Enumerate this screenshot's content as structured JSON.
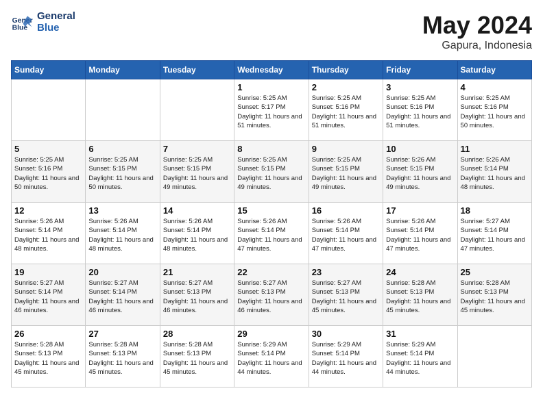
{
  "header": {
    "logo_line1": "General",
    "logo_line2": "Blue",
    "month": "May 2024",
    "location": "Gapura, Indonesia"
  },
  "weekdays": [
    "Sunday",
    "Monday",
    "Tuesday",
    "Wednesday",
    "Thursday",
    "Friday",
    "Saturday"
  ],
  "weeks": [
    [
      {
        "day": "",
        "sunrise": "",
        "sunset": "",
        "daylight": ""
      },
      {
        "day": "",
        "sunrise": "",
        "sunset": "",
        "daylight": ""
      },
      {
        "day": "",
        "sunrise": "",
        "sunset": "",
        "daylight": ""
      },
      {
        "day": "1",
        "sunrise": "Sunrise: 5:25 AM",
        "sunset": "Sunset: 5:17 PM",
        "daylight": "Daylight: 11 hours and 51 minutes."
      },
      {
        "day": "2",
        "sunrise": "Sunrise: 5:25 AM",
        "sunset": "Sunset: 5:16 PM",
        "daylight": "Daylight: 11 hours and 51 minutes."
      },
      {
        "day": "3",
        "sunrise": "Sunrise: 5:25 AM",
        "sunset": "Sunset: 5:16 PM",
        "daylight": "Daylight: 11 hours and 51 minutes."
      },
      {
        "day": "4",
        "sunrise": "Sunrise: 5:25 AM",
        "sunset": "Sunset: 5:16 PM",
        "daylight": "Daylight: 11 hours and 50 minutes."
      }
    ],
    [
      {
        "day": "5",
        "sunrise": "Sunrise: 5:25 AM",
        "sunset": "Sunset: 5:16 PM",
        "daylight": "Daylight: 11 hours and 50 minutes."
      },
      {
        "day": "6",
        "sunrise": "Sunrise: 5:25 AM",
        "sunset": "Sunset: 5:15 PM",
        "daylight": "Daylight: 11 hours and 50 minutes."
      },
      {
        "day": "7",
        "sunrise": "Sunrise: 5:25 AM",
        "sunset": "Sunset: 5:15 PM",
        "daylight": "Daylight: 11 hours and 49 minutes."
      },
      {
        "day": "8",
        "sunrise": "Sunrise: 5:25 AM",
        "sunset": "Sunset: 5:15 PM",
        "daylight": "Daylight: 11 hours and 49 minutes."
      },
      {
        "day": "9",
        "sunrise": "Sunrise: 5:25 AM",
        "sunset": "Sunset: 5:15 PM",
        "daylight": "Daylight: 11 hours and 49 minutes."
      },
      {
        "day": "10",
        "sunrise": "Sunrise: 5:26 AM",
        "sunset": "Sunset: 5:15 PM",
        "daylight": "Daylight: 11 hours and 49 minutes."
      },
      {
        "day": "11",
        "sunrise": "Sunrise: 5:26 AM",
        "sunset": "Sunset: 5:14 PM",
        "daylight": "Daylight: 11 hours and 48 minutes."
      }
    ],
    [
      {
        "day": "12",
        "sunrise": "Sunrise: 5:26 AM",
        "sunset": "Sunset: 5:14 PM",
        "daylight": "Daylight: 11 hours and 48 minutes."
      },
      {
        "day": "13",
        "sunrise": "Sunrise: 5:26 AM",
        "sunset": "Sunset: 5:14 PM",
        "daylight": "Daylight: 11 hours and 48 minutes."
      },
      {
        "day": "14",
        "sunrise": "Sunrise: 5:26 AM",
        "sunset": "Sunset: 5:14 PM",
        "daylight": "Daylight: 11 hours and 48 minutes."
      },
      {
        "day": "15",
        "sunrise": "Sunrise: 5:26 AM",
        "sunset": "Sunset: 5:14 PM",
        "daylight": "Daylight: 11 hours and 47 minutes."
      },
      {
        "day": "16",
        "sunrise": "Sunrise: 5:26 AM",
        "sunset": "Sunset: 5:14 PM",
        "daylight": "Daylight: 11 hours and 47 minutes."
      },
      {
        "day": "17",
        "sunrise": "Sunrise: 5:26 AM",
        "sunset": "Sunset: 5:14 PM",
        "daylight": "Daylight: 11 hours and 47 minutes."
      },
      {
        "day": "18",
        "sunrise": "Sunrise: 5:27 AM",
        "sunset": "Sunset: 5:14 PM",
        "daylight": "Daylight: 11 hours and 47 minutes."
      }
    ],
    [
      {
        "day": "19",
        "sunrise": "Sunrise: 5:27 AM",
        "sunset": "Sunset: 5:14 PM",
        "daylight": "Daylight: 11 hours and 46 minutes."
      },
      {
        "day": "20",
        "sunrise": "Sunrise: 5:27 AM",
        "sunset": "Sunset: 5:14 PM",
        "daylight": "Daylight: 11 hours and 46 minutes."
      },
      {
        "day": "21",
        "sunrise": "Sunrise: 5:27 AM",
        "sunset": "Sunset: 5:13 PM",
        "daylight": "Daylight: 11 hours and 46 minutes."
      },
      {
        "day": "22",
        "sunrise": "Sunrise: 5:27 AM",
        "sunset": "Sunset: 5:13 PM",
        "daylight": "Daylight: 11 hours and 46 minutes."
      },
      {
        "day": "23",
        "sunrise": "Sunrise: 5:27 AM",
        "sunset": "Sunset: 5:13 PM",
        "daylight": "Daylight: 11 hours and 45 minutes."
      },
      {
        "day": "24",
        "sunrise": "Sunrise: 5:28 AM",
        "sunset": "Sunset: 5:13 PM",
        "daylight": "Daylight: 11 hours and 45 minutes."
      },
      {
        "day": "25",
        "sunrise": "Sunrise: 5:28 AM",
        "sunset": "Sunset: 5:13 PM",
        "daylight": "Daylight: 11 hours and 45 minutes."
      }
    ],
    [
      {
        "day": "26",
        "sunrise": "Sunrise: 5:28 AM",
        "sunset": "Sunset: 5:13 PM",
        "daylight": "Daylight: 11 hours and 45 minutes."
      },
      {
        "day": "27",
        "sunrise": "Sunrise: 5:28 AM",
        "sunset": "Sunset: 5:13 PM",
        "daylight": "Daylight: 11 hours and 45 minutes."
      },
      {
        "day": "28",
        "sunrise": "Sunrise: 5:28 AM",
        "sunset": "Sunset: 5:13 PM",
        "daylight": "Daylight: 11 hours and 45 minutes."
      },
      {
        "day": "29",
        "sunrise": "Sunrise: 5:29 AM",
        "sunset": "Sunset: 5:14 PM",
        "daylight": "Daylight: 11 hours and 44 minutes."
      },
      {
        "day": "30",
        "sunrise": "Sunrise: 5:29 AM",
        "sunset": "Sunset: 5:14 PM",
        "daylight": "Daylight: 11 hours and 44 minutes."
      },
      {
        "day": "31",
        "sunrise": "Sunrise: 5:29 AM",
        "sunset": "Sunset: 5:14 PM",
        "daylight": "Daylight: 11 hours and 44 minutes."
      },
      {
        "day": "",
        "sunrise": "",
        "sunset": "",
        "daylight": ""
      }
    ]
  ]
}
